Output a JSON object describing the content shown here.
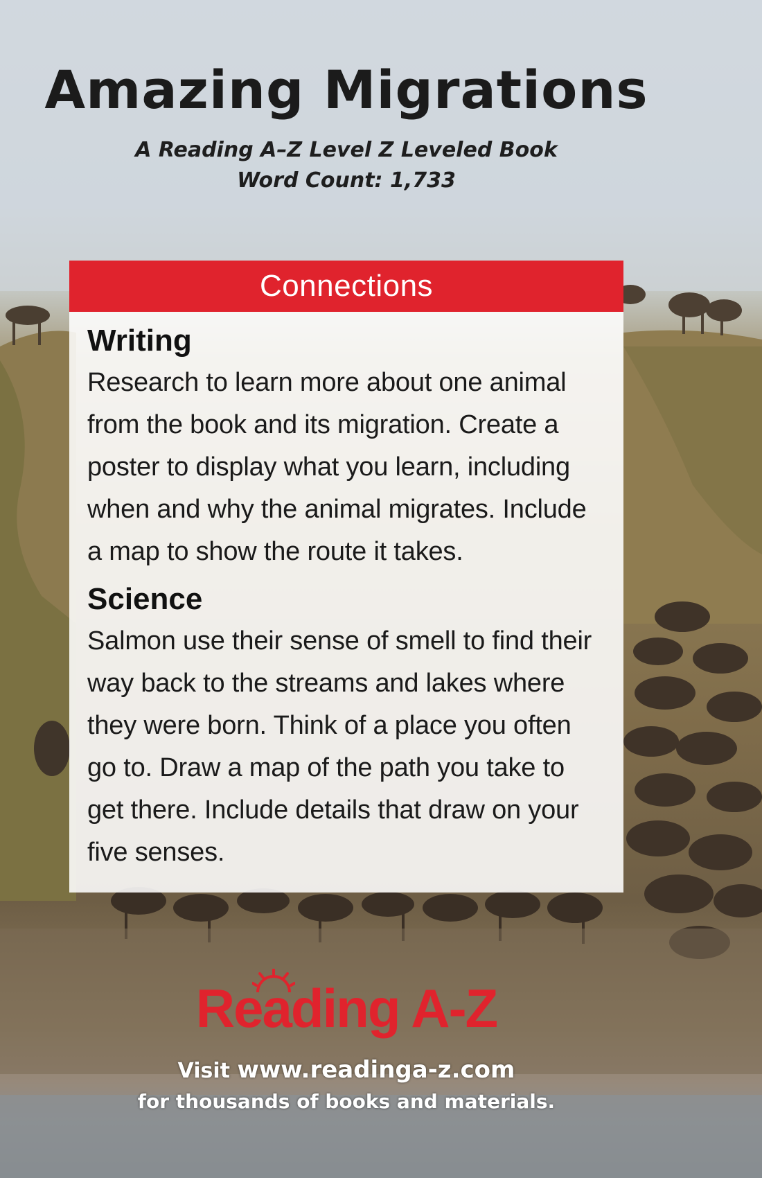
{
  "cover": {
    "title": "Amazing Migrations",
    "subtitle": "A Reading A–Z Level Z Leveled Book",
    "word_count": "Word Count: 1,733"
  },
  "connections": {
    "header": "Connections",
    "sections": [
      {
        "heading": "Writing",
        "text": "Research to learn more about one animal from the book and its migration. Create a poster to display what you learn, including when and why the animal migrates. Include a map to show the route it takes."
      },
      {
        "heading": "Science",
        "text": "Salmon use their sense of smell to find their way back to the streams and lakes where they were born. Think of a place you often go to. Draw a map of the path you take to get there. Include details that draw on your five senses."
      }
    ]
  },
  "footer": {
    "logo": "Reading A-Z",
    "visit_prefix": "Visit",
    "url": "www.readinga-z.com",
    "tagline": "for thousands of books and materials."
  },
  "colors": {
    "accent": "#e0232d",
    "card_background": "#ffffff"
  },
  "icons": {
    "logo_sun": "sun-icon"
  }
}
